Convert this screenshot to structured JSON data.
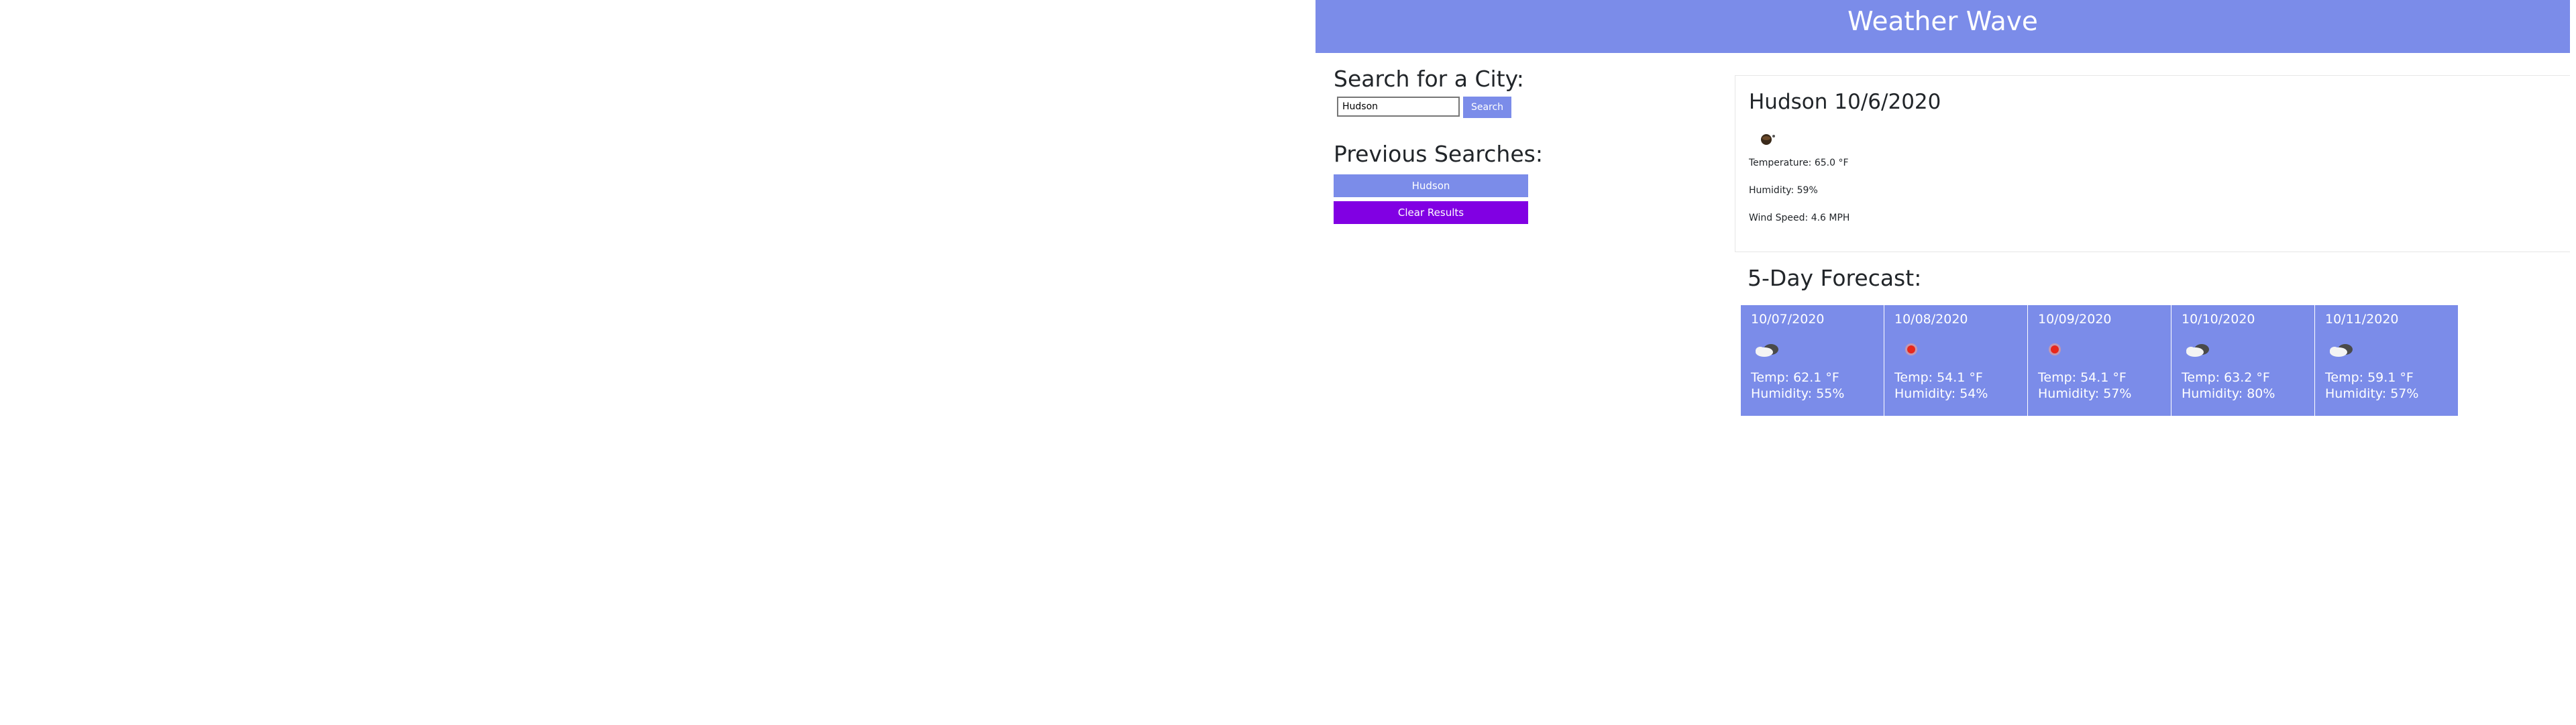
{
  "app": {
    "title": "Weather Wave"
  },
  "search": {
    "heading": "Search for a City:",
    "input_value": "Hudson",
    "button_label": "Search"
  },
  "history": {
    "heading": "Previous Searches:",
    "items": [
      "Hudson"
    ],
    "clear_label": "Clear Results"
  },
  "current": {
    "city": "Hudson",
    "date": "10/6/2020",
    "icon": "night-cloud-icon",
    "temperature": "Temperature: 65.0 °F",
    "humidity": "Humidity: 59%",
    "wind": "Wind Speed: 4.6 MPH"
  },
  "forecast": {
    "heading": "5-Day Forecast:",
    "days": [
      {
        "date": "10/07/2020",
        "icon": "cloudy-icon",
        "temp": "Temp: 62.1 °F",
        "humidity": "Humidity: 55%"
      },
      {
        "date": "10/08/2020",
        "icon": "sun-icon",
        "temp": "Temp: 54.1 °F",
        "humidity": "Humidity: 54%"
      },
      {
        "date": "10/09/2020",
        "icon": "sun-icon",
        "temp": "Temp: 54.1 °F",
        "humidity": "Humidity: 57%"
      },
      {
        "date": "10/10/2020",
        "icon": "cloudy-icon",
        "temp": "Temp: 63.2 °F",
        "humidity": "Humidity: 80%"
      },
      {
        "date": "10/11/2020",
        "icon": "cloudy-icon",
        "temp": "Temp: 59.1 °F",
        "humidity": "Humidity: 57%"
      }
    ]
  },
  "colors": {
    "primary": "#7b8ce9",
    "clear_button": "#8100e3",
    "sun": "#e8271b"
  }
}
